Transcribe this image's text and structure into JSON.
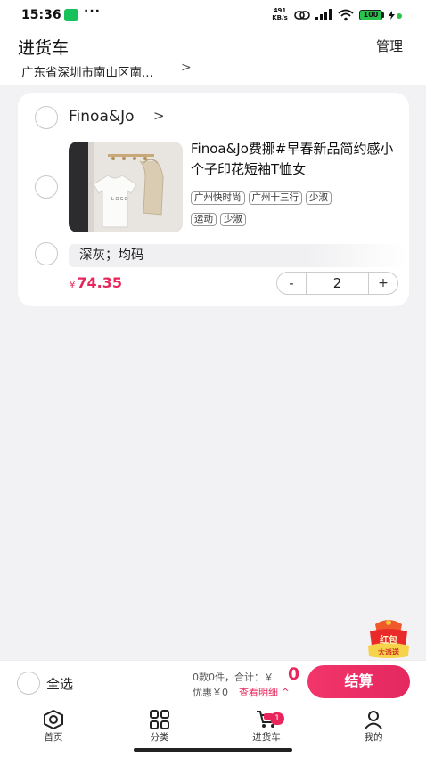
{
  "status_bar": {
    "time": "15:36",
    "more": "···",
    "net_speed_value": "491",
    "net_speed_unit": "KB/s",
    "battery": "100"
  },
  "header": {
    "title": "进货车",
    "manage": "管理",
    "address": "广东省深圳市南山区南...",
    "address_arrow": ">"
  },
  "cart": {
    "shop_name": "Finoa&Jo",
    "shop_arrow": ">",
    "product_title": "Finoa&Jo费挪#早春新品简约感小个子印花短袖T恤女",
    "tags": [
      "广州快时尚",
      "广州十三行",
      "少淑",
      "运动",
      "少淑"
    ],
    "sku": "深灰；均码",
    "currency": "¥",
    "price": "74.35",
    "quantity": "2",
    "minus": "-",
    "plus": "+"
  },
  "red_packet": {
    "line1": "红包",
    "line2": "大派送"
  },
  "bottom": {
    "select_all": "全选",
    "summary_count": "0款0件，合计：￥",
    "total": "0",
    "discount": "优惠￥0",
    "detail": "查看明细 ^",
    "checkout": "结算"
  },
  "tabs": [
    {
      "label": "首页",
      "icon": "home-icon"
    },
    {
      "label": "分类",
      "icon": "category-icon"
    },
    {
      "label": "进货车",
      "icon": "cart-icon",
      "badge": "1",
      "active": true
    },
    {
      "label": "我的",
      "icon": "profile-icon"
    }
  ],
  "colors": {
    "accent": "#e8265b",
    "background": "#f2f2f4"
  }
}
